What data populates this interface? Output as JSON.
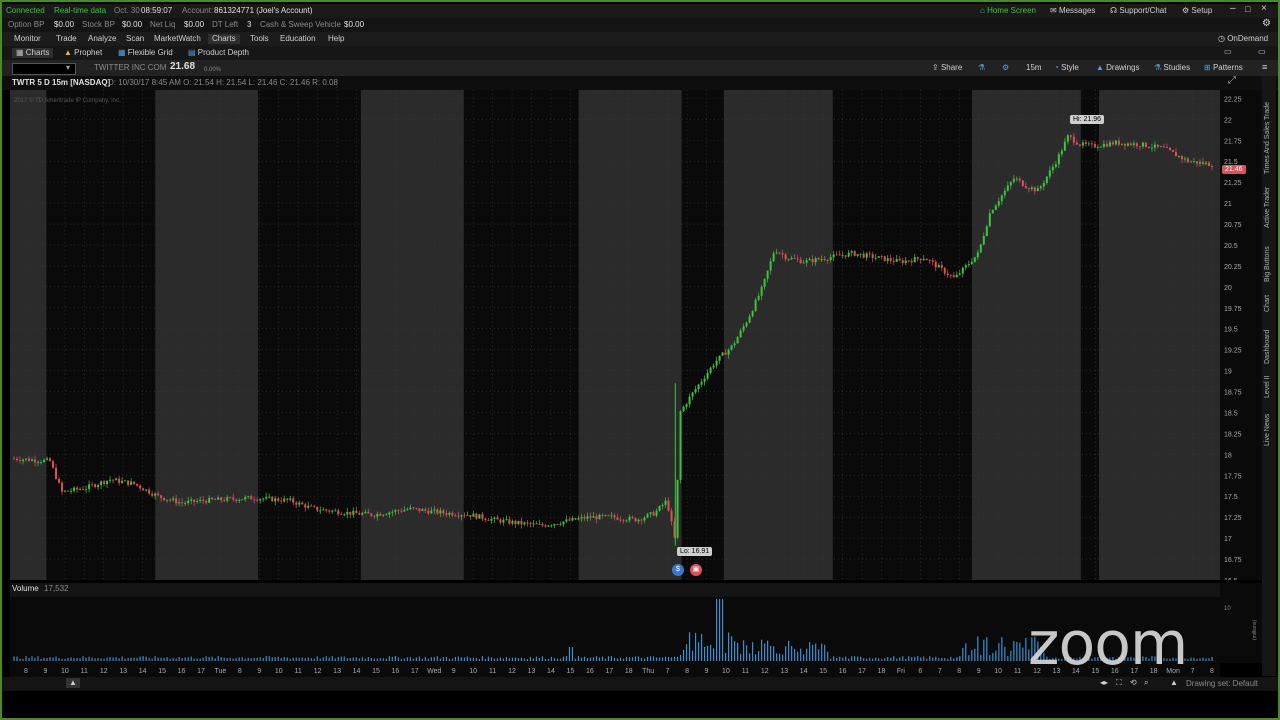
{
  "status": {
    "connected": "Connected",
    "realtime": "Real-time data",
    "date": "Oct. 30",
    "time": "08:59:07",
    "account_label": "Account:",
    "account": "861324771 (Joel's Account)",
    "home_screen": "Home Screen",
    "messages": "Messages",
    "support": "Support/Chat",
    "setup": "Setup"
  },
  "acct": {
    "items": [
      {
        "label": "Option BP",
        "value": "$0.00"
      },
      {
        "label": "Stock BP",
        "value": "$0.00"
      },
      {
        "label": "Net Liq",
        "value": "$0.00"
      },
      {
        "label": "DT Left",
        "value": "3"
      },
      {
        "label": "Cash & Sweep Vehicle",
        "value": "$0.00"
      }
    ]
  },
  "menu": {
    "items": [
      "Monitor",
      "Trade",
      "Analyze",
      "Scan",
      "MarketWatch",
      "Charts",
      "Tools",
      "Education",
      "Help"
    ],
    "ondemand": "OnDemand"
  },
  "subtabs": {
    "items": [
      "Charts",
      "Prophet",
      "Flexible Grid",
      "Product Depth"
    ]
  },
  "symbol": {
    "name": "TWITTER INC COM",
    "price": "21.68",
    "change": "0.00%",
    "share": "Share",
    "interval": "15m",
    "style": "Style",
    "drawings": "Drawings",
    "studies": "Studies",
    "patterns": "Patterns"
  },
  "chartinfo": {
    "title": "TWTR 5 D 15m [NASDAQ]",
    "ohlc": "D: 10/30/17 8:45 AM   O: 21.54   H: 21.54   L: 21.46   C: 21.46   R: 0.08",
    "copyright": "2017 © TD Ameritrade IP Company, Inc."
  },
  "chart": {
    "hi_label": "Hi: 21.96",
    "lo_label": "Lo: 16.91",
    "last_price": "21.46",
    "volume_label": "Volume",
    "volume_value": "17,532",
    "vol_axis_label": "10",
    "vol_axis_unit": "(millions)",
    "colors": {
      "up": "#3ec43e",
      "down": "#e0505a",
      "volume": "#3a8fd0",
      "session": "#2b2b2b"
    }
  },
  "chart_data": {
    "type": "candlestick",
    "title": "TWTR 5 D 15m [NASDAQ]",
    "ylim": [
      16.5,
      22.35
    ],
    "yticks": [
      22.25,
      22,
      21.75,
      21.5,
      21.25,
      21,
      20.75,
      20.5,
      20.25,
      20,
      19.75,
      19.5,
      19.25,
      19,
      18.75,
      18.5,
      18.25,
      18,
      17.75,
      17.5,
      17.25,
      17,
      16.75,
      16.5
    ],
    "xticks": [
      "8",
      "9",
      "10",
      "11",
      "12",
      "13",
      "14",
      "15",
      "16",
      "17",
      "Tue",
      "8",
      "9",
      "10",
      "11",
      "12",
      "13",
      "14",
      "15",
      "16",
      "17",
      "Wed",
      "9",
      "10",
      "11",
      "12",
      "13",
      "14",
      "15",
      "16",
      "17",
      "18",
      "Thu",
      "7",
      "8",
      "9",
      "10",
      "11",
      "12",
      "13",
      "14",
      "15",
      "16",
      "17",
      "18",
      "Fri",
      "6",
      "7",
      "8",
      "9",
      "10",
      "11",
      "12",
      "13",
      "14",
      "15",
      "16",
      "17",
      "18",
      "Mon",
      "7",
      "8"
    ],
    "price_path": [
      [
        0,
        17.95
      ],
      [
        0.03,
        17.92
      ],
      [
        0.04,
        17.55
      ],
      [
        0.06,
        17.6
      ],
      [
        0.08,
        17.7
      ],
      [
        0.1,
        17.65
      ],
      [
        0.12,
        17.5
      ],
      [
        0.14,
        17.42
      ],
      [
        0.16,
        17.45
      ],
      [
        0.2,
        17.48
      ],
      [
        0.23,
        17.45
      ],
      [
        0.25,
        17.35
      ],
      [
        0.28,
        17.3
      ],
      [
        0.3,
        17.28
      ],
      [
        0.33,
        17.35
      ],
      [
        0.36,
        17.3
      ],
      [
        0.38,
        17.28
      ],
      [
        0.4,
        17.22
      ],
      [
        0.42,
        17.18
      ],
      [
        0.44,
        17.15
      ],
      [
        0.46,
        17.2
      ],
      [
        0.48,
        17.25
      ],
      [
        0.5,
        17.25
      ],
      [
        0.52,
        17.22
      ],
      [
        0.535,
        17.3
      ],
      [
        0.545,
        17.45
      ],
      [
        0.552,
        16.95
      ],
      [
        0.556,
        18.5
      ],
      [
        0.565,
        18.7
      ],
      [
        0.575,
        18.9
      ],
      [
        0.585,
        19.1
      ],
      [
        0.6,
        19.3
      ],
      [
        0.612,
        19.6
      ],
      [
        0.625,
        20.0
      ],
      [
        0.635,
        20.45
      ],
      [
        0.645,
        20.35
      ],
      [
        0.66,
        20.3
      ],
      [
        0.68,
        20.35
      ],
      [
        0.7,
        20.4
      ],
      [
        0.72,
        20.35
      ],
      [
        0.74,
        20.3
      ],
      [
        0.76,
        20.35
      ],
      [
        0.775,
        20.2
      ],
      [
        0.785,
        20.1
      ],
      [
        0.795,
        20.25
      ],
      [
        0.805,
        20.4
      ],
      [
        0.815,
        20.9
      ],
      [
        0.825,
        21.1
      ],
      [
        0.835,
        21.3
      ],
      [
        0.845,
        21.2
      ],
      [
        0.855,
        21.15
      ],
      [
        0.87,
        21.5
      ],
      [
        0.88,
        21.8
      ],
      [
        0.89,
        21.7
      ],
      [
        0.9,
        21.68
      ],
      [
        0.92,
        21.72
      ],
      [
        0.94,
        21.7
      ],
      [
        0.96,
        21.65
      ],
      [
        0.98,
        21.5
      ],
      [
        1.0,
        21.46
      ]
    ],
    "session_shading": true,
    "grid": true
  }
}
